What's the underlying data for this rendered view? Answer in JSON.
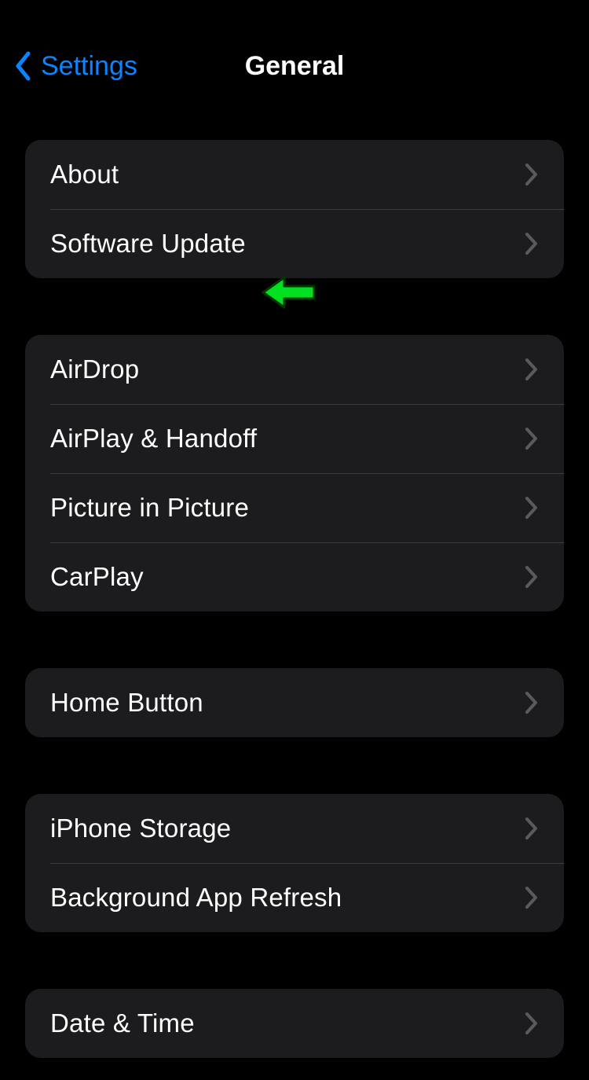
{
  "nav": {
    "back_label": "Settings",
    "title": "General"
  },
  "groups": [
    {
      "items": [
        {
          "id": "about",
          "label": "About"
        },
        {
          "id": "software-update",
          "label": "Software Update"
        }
      ]
    },
    {
      "items": [
        {
          "id": "airdrop",
          "label": "AirDrop"
        },
        {
          "id": "airplay-handoff",
          "label": "AirPlay & Handoff"
        },
        {
          "id": "picture-in-picture",
          "label": "Picture in Picture"
        },
        {
          "id": "carplay",
          "label": "CarPlay"
        }
      ]
    },
    {
      "items": [
        {
          "id": "home-button",
          "label": "Home Button"
        }
      ]
    },
    {
      "items": [
        {
          "id": "iphone-storage",
          "label": "iPhone Storage"
        },
        {
          "id": "background-app-refresh",
          "label": "Background App Refresh"
        }
      ]
    },
    {
      "items": [
        {
          "id": "date-time",
          "label": "Date & Time"
        }
      ]
    }
  ],
  "colors": {
    "tint": "#0a84ff",
    "cell_bg": "#1c1c1e",
    "separator": "#3a3a3c",
    "chevron": "#5a5a5e"
  }
}
